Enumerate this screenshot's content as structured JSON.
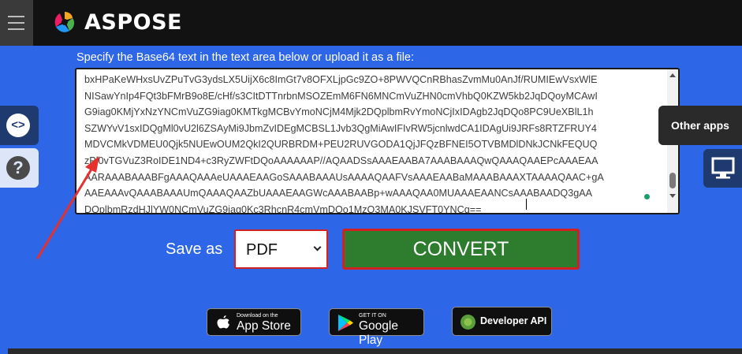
{
  "header": {
    "brand": "ASPOSE"
  },
  "main": {
    "instruction": "Specify the Base64 text in the text area below or upload it as a file:",
    "textarea_value": "bxHPaKeWHxsUvZPuTvG3ydsLX5UijX6c8ImGt7v8OFXLjpGc9ZO+8PWVQCnRBhasZvmMu0AnJf/RUMIEwVsxWlE\nNISawYnIp4FQt3bFMrB9o8E/cHf/s3CItDTTnrbnMSOZEmM6FN6MNCmVuZHN0cmVhbQ0KZW5kb2JqDQoyMCAwI\nG9iag0KMjYxNzYNCmVuZG9iag0KMTkgMCBvYmoNCjM4Mjk2DQplbmRvYmoNCjIxIDAgb2JqDQo8PC9UeXBlL1h\nSZWYvV1sxIDQgMl0vU2l6ZSAyMi9JbmZvIDEgMCBSL1Jvb3QgMiAwIFIvRW5jcnlwdCA1IDAgUi9JRFs8RTZFRUY4\nMDVCMkVDMEU0Qjk5NUEwOUM2QkI2QURBRDM+PEU2RUVGODA1QjJFQzBFNEI5OTVBMDlDNkJCNkFEQUQ\nzPl0vTGVuZ3RoIDE1ND4+c3RyZWFtDQoAAAAAAP//AQAADSsAAAEAABA7AAABAAAQwQAAAQAAEPcAAAEAA\nAARAAABAAABFgAAAQAAAeUAAAEAAGoSAAABAAAUsAAAAQAAFVsAAAEAABaMAAABAAAXTAAAAQAAC+gA\nAAEAAAvQAAABAAAUmQAAAQAAZbUAAAEAAGWcAAABAABp+wAAAQAA0MUAAAEAANCsAAABAADQ3gAA\nDQplbmRzdHJlYW0NCmVuZG9iag0Kc3RhcnR4cmVmDQo1MzQ3MA0KJSVFT0YNCg==",
    "save_as_label": "Save as",
    "format_selected": "PDF",
    "convert_label": "CONVERT"
  },
  "side": {
    "other_apps_label": "Other apps"
  },
  "badges": {
    "appstore_small": "Download on the",
    "appstore_big": "App Store",
    "googleplay_small": "GET IT ON",
    "googleplay_big": "Google Play",
    "devapi_big": "Developer API"
  },
  "colors": {
    "background": "#2d66e6",
    "convert": "#2e7d2e",
    "highlight_border": "#d32020",
    "annotation_arrow": "#e53030"
  },
  "icons": {
    "menu": "hamburger-menu-icon",
    "logo": "aspose-logo-icon",
    "code": "code-icon",
    "help": "question-icon",
    "monitor": "monitor-icon",
    "apple": "apple-icon",
    "googleplay": "google-play-icon",
    "devapi": "developer-api-icon"
  }
}
